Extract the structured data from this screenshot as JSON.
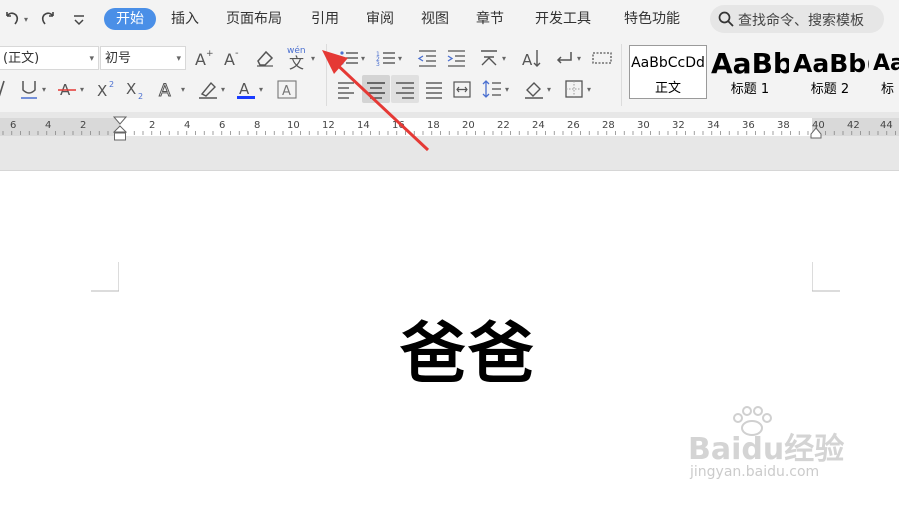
{
  "quick_access": {
    "undo_icon": "undo-icon",
    "redo_icon": "redo-icon",
    "more_icon": "chevron-down-icon"
  },
  "menu": {
    "tabs": [
      {
        "label": "开始",
        "active": true
      },
      {
        "label": "插入"
      },
      {
        "label": "页面布局"
      },
      {
        "label": "引用"
      },
      {
        "label": "审阅"
      },
      {
        "label": "视图"
      },
      {
        "label": "章节"
      },
      {
        "label": "开发工具"
      },
      {
        "label": "特色功能"
      }
    ],
    "search_placeholder": "查找命令、搜索模板"
  },
  "font": {
    "name": "(正文)",
    "size": "初号",
    "phonetic_label": "wén"
  },
  "styles": [
    {
      "preview": "AaBbCcDd",
      "label": "正文"
    },
    {
      "preview": "AaBb",
      "label": "标题 1"
    },
    {
      "preview": "AaBb(",
      "label": "标题 2"
    },
    {
      "preview": "Aa",
      "label": "标"
    }
  ],
  "ruler": {
    "left_ticks": [
      "6",
      "4",
      "2"
    ],
    "right_ticks": [
      "2",
      "4",
      "6",
      "8",
      "10",
      "12",
      "14",
      "16",
      "18",
      "20",
      "22",
      "24",
      "26",
      "28",
      "30",
      "32",
      "34",
      "36",
      "38",
      "40",
      "42",
      "44"
    ]
  },
  "document": {
    "text": "爸爸"
  },
  "watermark": {
    "brand": "Baidu经验",
    "url": "jingyan.baidu.com"
  },
  "colors": {
    "accent": "#4a8fe7",
    "arrow": "#e53935",
    "font_color_bar": "#1a3cff"
  }
}
